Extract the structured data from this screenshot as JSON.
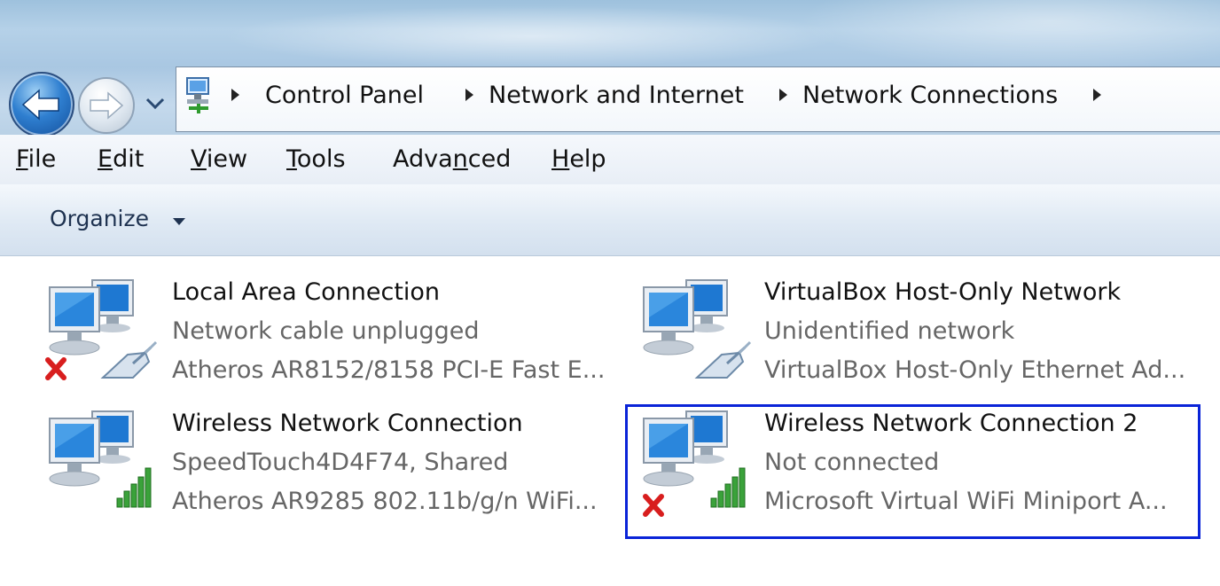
{
  "breadcrumb": {
    "items": [
      "Control Panel",
      "Network and Internet",
      "Network Connections"
    ]
  },
  "menu": {
    "file": {
      "pre": "",
      "key": "F",
      "post": "ile"
    },
    "edit": {
      "pre": "",
      "key": "E",
      "post": "dit"
    },
    "view": {
      "pre": "",
      "key": "V",
      "post": "iew"
    },
    "tools": {
      "pre": "",
      "key": "T",
      "post": "ools"
    },
    "advanced": {
      "pre": "Adva",
      "key": "n",
      "post": "ced"
    },
    "help": {
      "pre": "",
      "key": "H",
      "post": "elp"
    }
  },
  "toolbar": {
    "organize_label": "Organize"
  },
  "connections": [
    {
      "name": "Local Area Connection",
      "status": "Network cable unplugged",
      "device": "Atheros AR8152/8158 PCI-E Fast E...",
      "type": "ethernet",
      "disconnected": true
    },
    {
      "name": "VirtualBox Host-Only Network",
      "status": "Unidentified network",
      "device": "VirtualBox Host-Only Ethernet Ad...",
      "type": "ethernet",
      "disconnected": false
    },
    {
      "name": "Wireless Network Connection",
      "status": "SpeedTouch4D4F74, Shared",
      "device": "Atheros AR9285 802.11b/g/n WiFi...",
      "type": "wireless",
      "disconnected": false
    },
    {
      "name": "Wireless Network Connection 2",
      "status": "Not connected",
      "device": "Microsoft Virtual WiFi Miniport A...",
      "type": "wireless",
      "disconnected": true,
      "selected": true
    }
  ],
  "colors": {
    "selection_border": "#0a24d8",
    "disconnect_x": "#d81e1e",
    "signal_bars": "#3aa23a",
    "secondary_text": "#666666"
  },
  "icons": [
    "back-arrow-icon",
    "forward-arrow-icon",
    "network-folder-icon",
    "network-computers-icon",
    "ethernet-plug-icon",
    "wireless-signal-icon",
    "disconnected-x-icon"
  ]
}
